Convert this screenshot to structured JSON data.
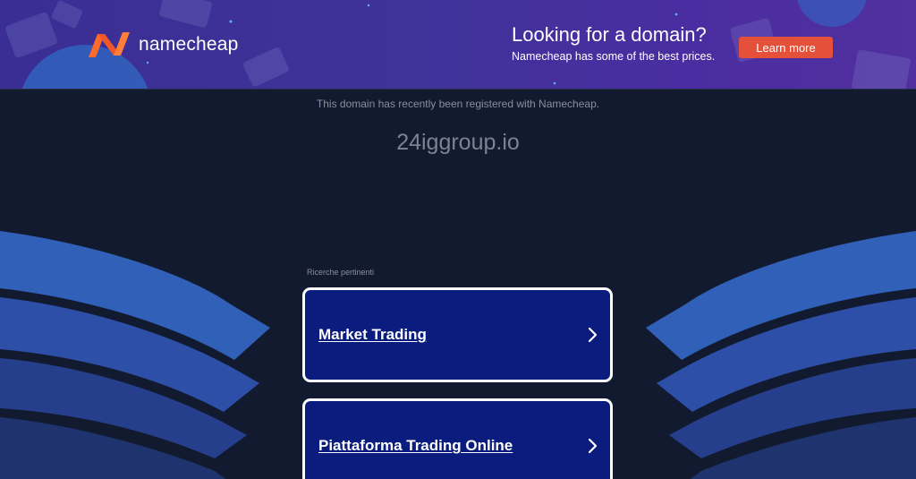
{
  "banner": {
    "logo_text": "namecheap",
    "promo_title": "Looking for a domain?",
    "promo_subtitle": "Namecheap has some of the best prices.",
    "cta_label": "Learn more",
    "colors": {
      "background": "#3f3399",
      "cta": "#e4503a",
      "logo_orange": "#ff6a2b"
    }
  },
  "main": {
    "registered_note": "This domain has recently been registered with Namecheap.",
    "domain": "24iggroup.io"
  },
  "related": {
    "label": "Ricerche pertinenti",
    "items": [
      {
        "label": "Market Trading",
        "icon": "chevron-right-icon"
      },
      {
        "label": "Piattaforma Trading Online",
        "icon": "chevron-right-icon"
      }
    ]
  },
  "colors": {
    "page_background": "#121a30",
    "card_background": "#0b1c7f",
    "wave_light": "#3160b8",
    "wave_mid": "#2d4fa8",
    "wave_dark": "#233a82"
  }
}
